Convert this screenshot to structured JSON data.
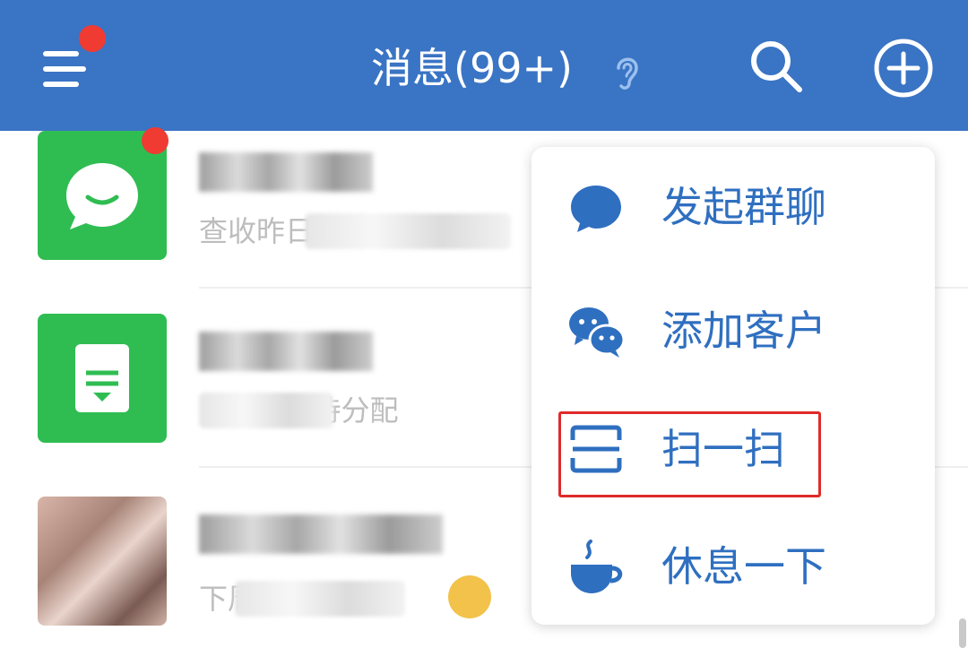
{
  "header": {
    "title": "消息(99+)",
    "icons": [
      "menu-icon",
      "ear-icon",
      "search-icon",
      "add-circle-icon"
    ],
    "background_color": "#3a74c4",
    "badge_color": "#f03b32"
  },
  "chats": [
    {
      "name": "",
      "preview": "查收昨日...数据",
      "avatar": "chat-bubble-icon",
      "has_badge": true
    },
    {
      "name": "",
      "preview": "...的客户待分配",
      "avatar": "document-icon",
      "has_badge": false
    },
    {
      "name": "",
      "preview": "下周...奶茶",
      "avatar": "photo-avatar",
      "has_badge": false
    }
  ],
  "popover": {
    "items": [
      {
        "label": "发起群聊",
        "icon": "chat-bubble-icon"
      },
      {
        "label": "添加客户",
        "icon": "wechat-icon"
      },
      {
        "label": "扫一扫",
        "icon": "scan-icon"
      },
      {
        "label": "休息一下",
        "icon": "coffee-cup-icon"
      }
    ],
    "accent_color": "#2f6fc0",
    "highlighted_item": "扫一扫",
    "highlight_color": "#e02a2a"
  }
}
